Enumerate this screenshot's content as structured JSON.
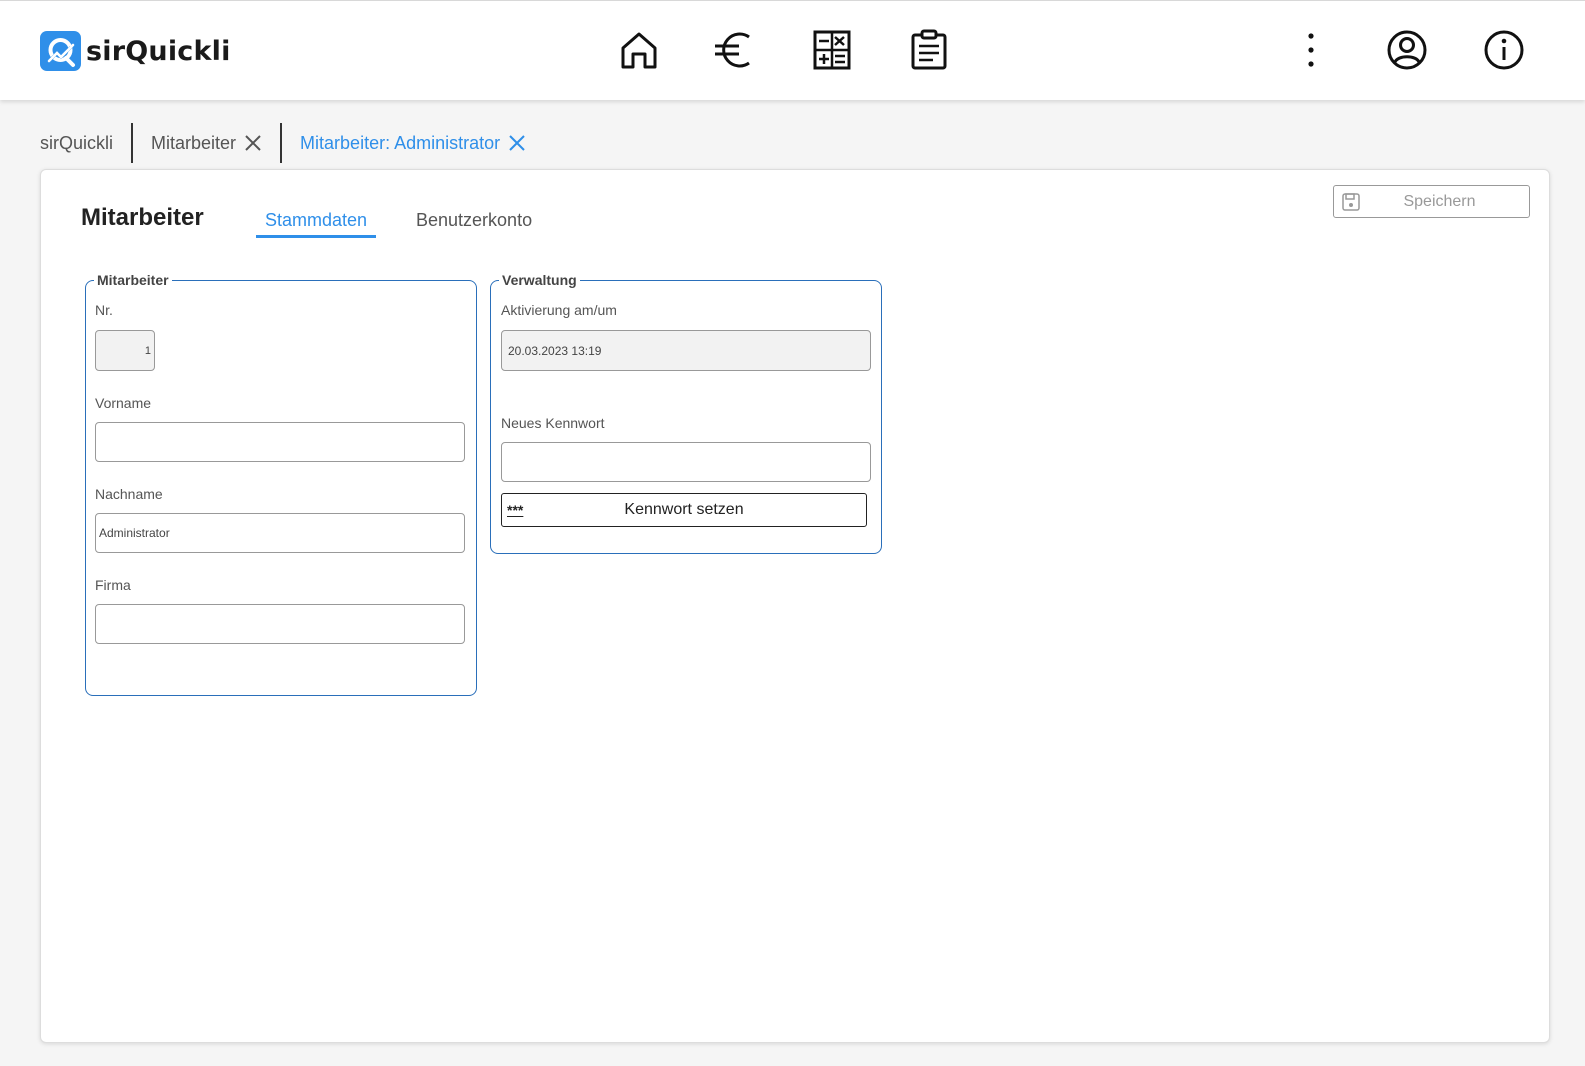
{
  "app": {
    "name": "sirQuickli"
  },
  "header": {
    "nav_icons": [
      "home-icon",
      "euro-icon",
      "calculator-icon",
      "clipboard-icon"
    ],
    "right_icons": [
      "more-vertical-icon",
      "user-account-icon",
      "info-icon"
    ]
  },
  "breadcrumb": {
    "items": [
      {
        "label": "sirQuickli"
      },
      {
        "label": "Mitarbeiter"
      },
      {
        "label": "Mitarbeiter: Administrator"
      }
    ]
  },
  "page": {
    "title": "Mitarbeiter",
    "tabs": [
      {
        "label": "Stammdaten",
        "active": true
      },
      {
        "label": "Benutzerkonto",
        "active": false
      }
    ],
    "save_label": "Speichern"
  },
  "mitarbeiter_group": {
    "legend": "Mitarbeiter",
    "nr_label": "Nr.",
    "nr_value": "1",
    "vorname_label": "Vorname",
    "vorname_value": "",
    "nachname_label": "Nachname",
    "nachname_value": "Administrator",
    "firma_label": "Firma",
    "firma_value": ""
  },
  "verwaltung_group": {
    "legend": "Verwaltung",
    "activation_label": "Aktivierung am/um",
    "activation_value": "20.03.2023 13:19",
    "new_password_label": "Neues Kennwort",
    "new_password_value": "",
    "set_password_button_icon_text": "***",
    "set_password_button_label": "Kennwort setzen"
  },
  "colors": {
    "accent": "#2f8fe9",
    "group_border": "#2a6fba",
    "background": "#f5f5f5"
  }
}
